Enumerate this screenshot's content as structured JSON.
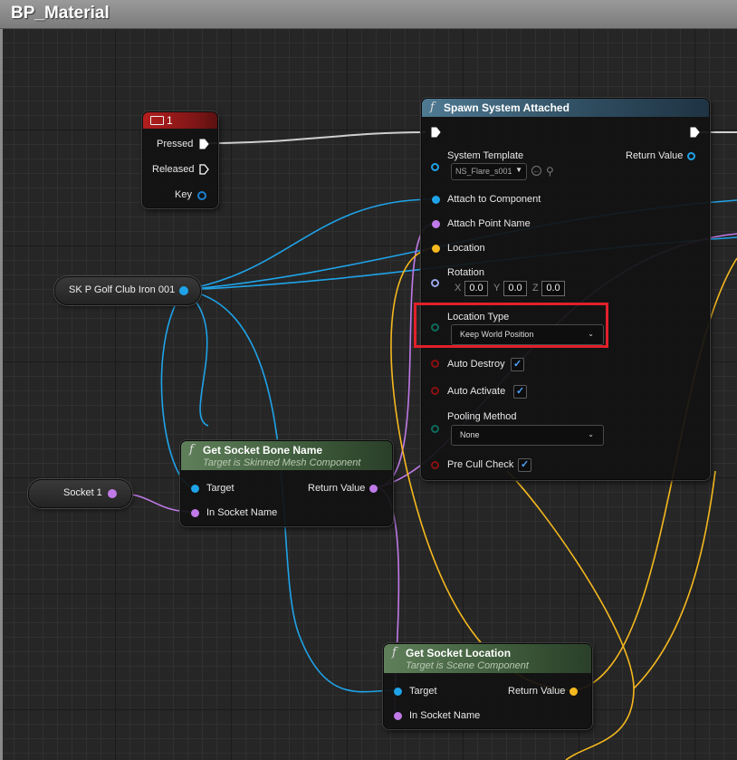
{
  "window": {
    "title": "BP_Material"
  },
  "key_event": {
    "title": "1",
    "pins": {
      "pressed": "Pressed",
      "released": "Released",
      "key": "Key"
    }
  },
  "variable_golf": {
    "label": "SK P Golf Club Iron 001"
  },
  "variable_socket": {
    "label": "Socket 1"
  },
  "spawn_node": {
    "title": "Spawn System Attached",
    "pins": {
      "system_template": "System Template",
      "system_template_value": "NS_Flare_s001",
      "return_value": "Return Value",
      "attach_to_component": "Attach to Component",
      "attach_point_name": "Attach Point Name",
      "location": "Location",
      "rotation": "Rotation",
      "rotation_x_label": "X",
      "rotation_x": "0.0",
      "rotation_y_label": "Y",
      "rotation_y": "0.0",
      "rotation_z_label": "Z",
      "rotation_z": "0.0",
      "location_type": "Location Type",
      "location_type_value": "Keep World Position",
      "auto_destroy": "Auto Destroy",
      "auto_destroy_checked": true,
      "auto_activate": "Auto Activate",
      "auto_activate_checked": true,
      "pooling_method": "Pooling Method",
      "pooling_method_value": "None",
      "pre_cull_check": "Pre Cull Check",
      "pre_cull_check_checked": true
    }
  },
  "bone_node": {
    "title": "Get Socket Bone Name",
    "subtitle": "Target is Skinned Mesh Component",
    "pins": {
      "target": "Target",
      "in_socket_name": "In Socket Name",
      "return_value": "Return Value"
    }
  },
  "location_node": {
    "title": "Get Socket Location",
    "subtitle": "Target is Scene Component",
    "pins": {
      "target": "Target",
      "in_socket_name": "In Socket Name",
      "return_value": "Return Value"
    }
  },
  "colors": {
    "object_pin": "#1fa3e8",
    "name_pin": "#c07ae8",
    "vector_pin": "#f5b81e",
    "rotator_pin": "#9aa6e8",
    "bool_pin": "#8a1010",
    "enum_pin": "#0d6b5c",
    "exec_wire": "#cfcfcf",
    "highlight": "#e0202a"
  }
}
